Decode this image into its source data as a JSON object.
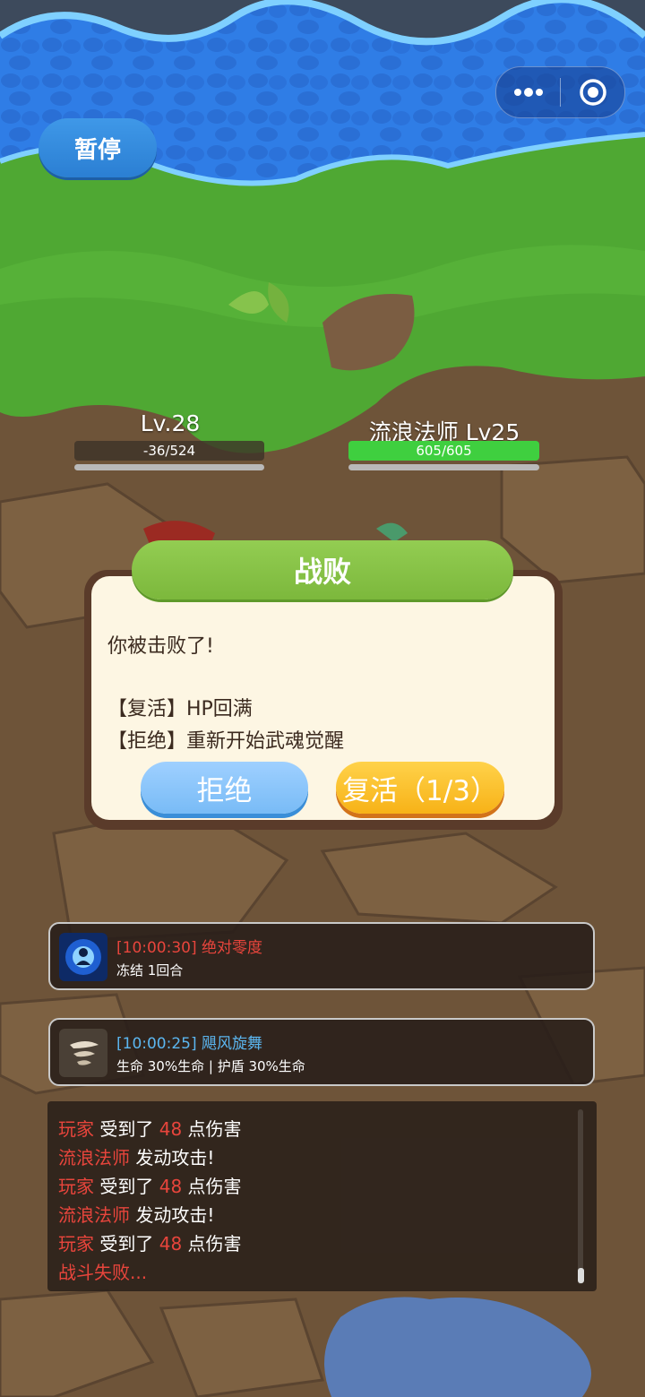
{
  "colors": {
    "accent_red": "#e8453c",
    "skill_blue": "#5bb6f0",
    "hp_green": "#3fcf3f"
  },
  "hud": {
    "pause_label": "暂停",
    "capsule_more_icon": "more-dots-icon",
    "capsule_close_icon": "target-close-icon"
  },
  "player": {
    "level": "Lv.28",
    "hp_text": "-36/524",
    "hp_fraction": 0
  },
  "enemy": {
    "name_level": "流浪法师 Lv25",
    "hp_text": "605/605",
    "hp_fraction": 1
  },
  "dialog": {
    "title": "战败",
    "message": "你被击败了!",
    "line1": "【复活】HP回满",
    "line2": "【拒绝】重新开始武魂觉醒",
    "refuse_label": "拒绝",
    "revive_label": "复活（1/3）"
  },
  "skills": [
    {
      "time_name": "[10:00:30] 绝对零度",
      "desc": "冻结 1回合",
      "icon": "ice-burst-icon",
      "color": "#e8453c"
    },
    {
      "time_name": "[10:00:25] 飓风旋舞",
      "desc": "生命 30%生命 | 护盾 30%生命",
      "icon": "whirlwind-icon",
      "color": "#5bb6f0"
    }
  ],
  "log": [
    {
      "who": "玩家",
      "mid": " 受到了 ",
      "num": "48",
      "tail": " 点伤害"
    },
    {
      "who": "流浪法师",
      "mid": " 发动攻击!",
      "num": "",
      "tail": ""
    },
    {
      "who": "玩家",
      "mid": " 受到了 ",
      "num": "48",
      "tail": " 点伤害"
    },
    {
      "who": "流浪法师",
      "mid": " 发动攻击!",
      "num": "",
      "tail": ""
    },
    {
      "who": "玩家",
      "mid": " 受到了 ",
      "num": "48",
      "tail": " 点伤害"
    },
    {
      "who": "战斗失败...",
      "mid": "",
      "num": "",
      "tail": ""
    }
  ]
}
